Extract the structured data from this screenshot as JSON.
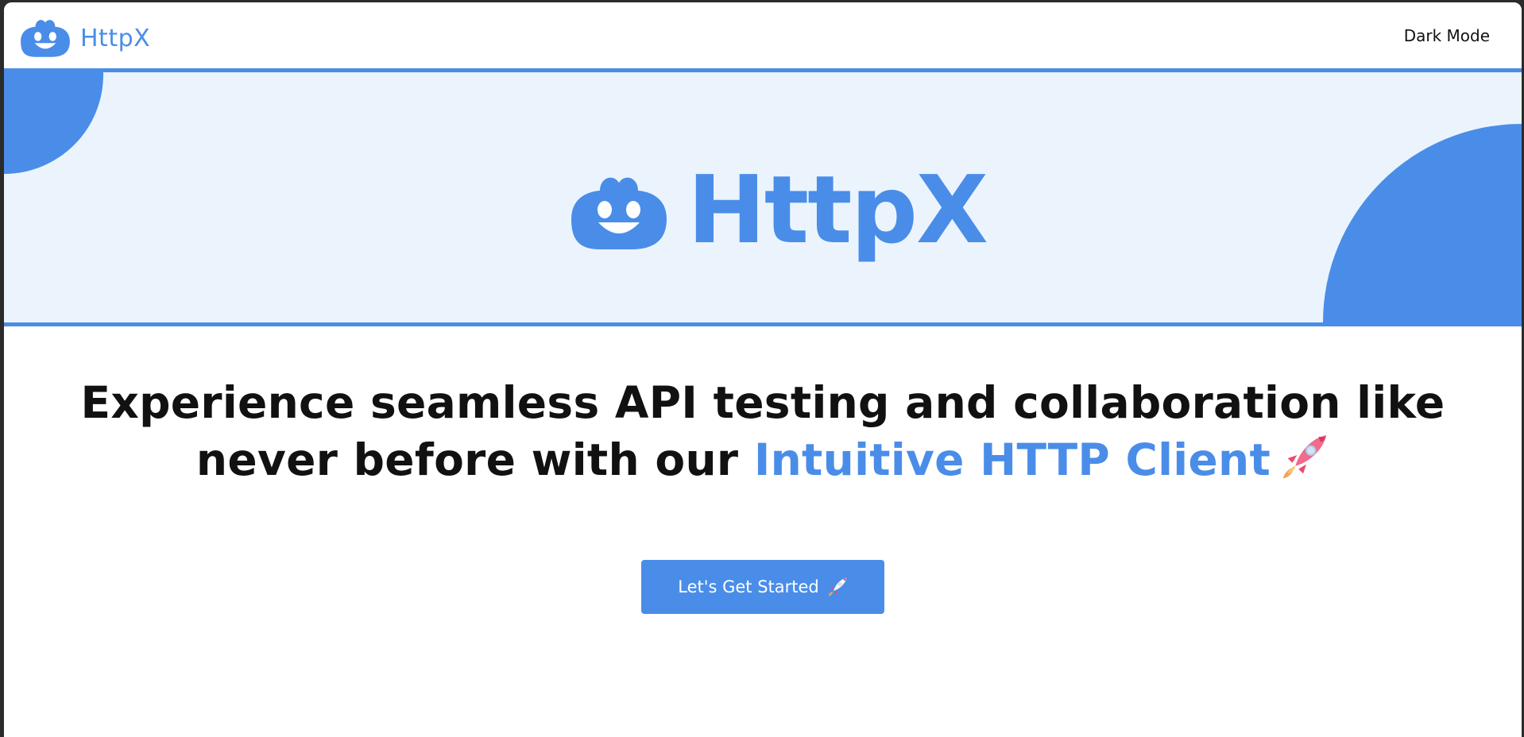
{
  "navbar": {
    "brand_name": "HttpX",
    "dark_mode_label": "Dark Mode"
  },
  "hero": {
    "logo_text": "HttpX"
  },
  "tagline": {
    "text_before": "Experience seamless API testing and collaboration like never before with our ",
    "highlight": "Intuitive HTTP Client"
  },
  "cta": {
    "label": "Let's Get Started"
  },
  "icons": {
    "brand_logo": "mascot-logo-icon",
    "hero_logo": "mascot-logo-icon",
    "tagline_rocket": "rocket-icon",
    "cta_rocket": "rocket-icon"
  },
  "colors": {
    "accent": "#4a8de9",
    "hero_background": "#ebf4fd",
    "text": "#111111",
    "background": "#ffffff"
  }
}
